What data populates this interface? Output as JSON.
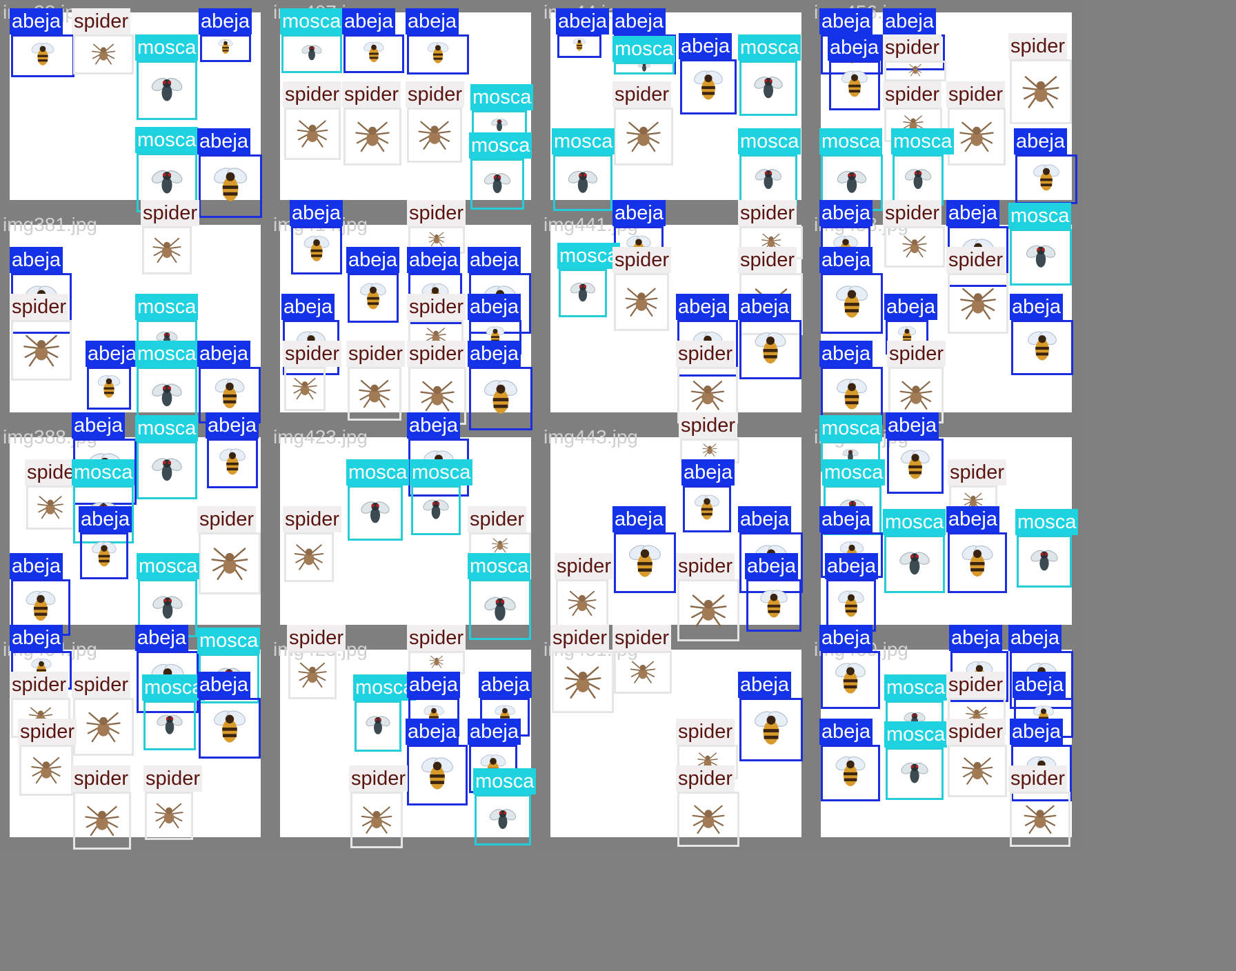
{
  "classes": {
    "abeja": {
      "label": "abeja",
      "box_color": "#1a2ee0",
      "label_bg": "#1432e8",
      "label_fg": "#ffffff",
      "icon": "bee-icon"
    },
    "mosca": {
      "label": "mosca",
      "box_color": "#25cdd9",
      "label_bg": "#1ed2df",
      "label_fg": "#ffffff",
      "icon": "fly-icon"
    },
    "spider": {
      "label": "spider",
      "box_color": "#e6e6e6",
      "label_bg": "#f0eeee",
      "label_fg": "#5a1410",
      "icon": "spider-icon"
    }
  },
  "tiles": [
    {
      "filename": "img38.jpg"
    },
    {
      "filename": "img407.jpg"
    },
    {
      "filename": "img44.jpg"
    },
    {
      "filename": "img456.jpg"
    },
    {
      "filename": "img381.jpg"
    },
    {
      "filename": "img414.jpg"
    },
    {
      "filename": "img441.jpg"
    },
    {
      "filename": "img458.jpg"
    },
    {
      "filename": "img388.jpg"
    },
    {
      "filename": "img423.jpg"
    },
    {
      "filename": "img443.jpg"
    },
    {
      "filename": "img459.jpg"
    },
    {
      "filename": "img404.jpg"
    },
    {
      "filename": "img425.jpg"
    },
    {
      "filename": "img451.jpg"
    },
    {
      "filename": "img460.jpg"
    }
  ]
}
